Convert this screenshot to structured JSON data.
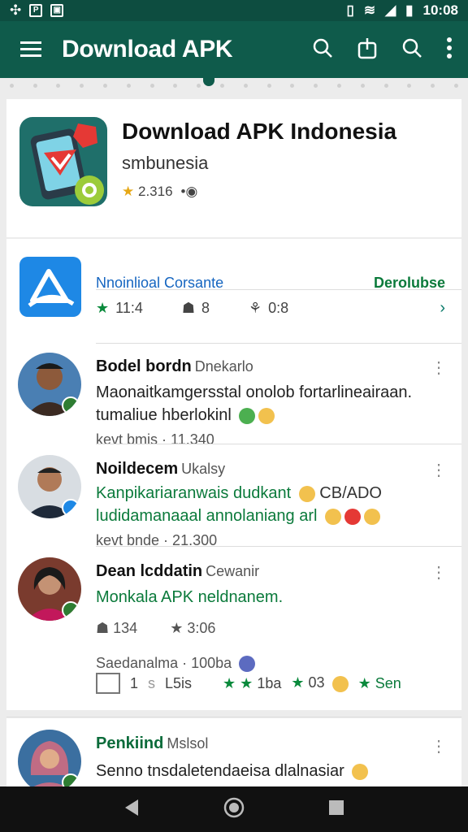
{
  "statusbar": {
    "time": "10:08"
  },
  "appbar": {
    "title": "Download APK"
  },
  "header": {
    "title": "Download APK Indonesia",
    "developer": "smbunesia",
    "rating": "2.316"
  },
  "app_row": {
    "name": "Nnoinlioal Corsante",
    "action": "Derolubse",
    "stat1": "11:4",
    "stat2": "8",
    "stat3": "0:8"
  },
  "reviews": [
    {
      "name": "Bodel bordn",
      "sub": "Dnekarlo",
      "body": "Maonaitkamgersstal onolob fortarlineairaan. tumaliue hberlokinl",
      "meta": "kevt bmis · 11.340"
    },
    {
      "name": "Noildecem",
      "sub": "Ukalsy",
      "body1": "Kanpikariaranwais dudkant",
      "body1b": "CB/ADO",
      "body2": "ludidamanaaal annolaniang arl",
      "meta": "kevt bnde · 21.300"
    },
    {
      "name": "Dean lcddatin",
      "sub": "Cewanir",
      "body": "Monkala APK neldnanem.",
      "likes": "134",
      "rating": "3:06",
      "meta": "Saedanalma · 100ba",
      "reply": "1",
      "reply_label": "L5is",
      "r1": "1ba",
      "r2": "03",
      "r3": "Sen"
    },
    {
      "name": "Penkiind",
      "sub": "Mslsol",
      "body": "Senno tnsdaletendaeisa dlalnasiar"
    }
  ]
}
